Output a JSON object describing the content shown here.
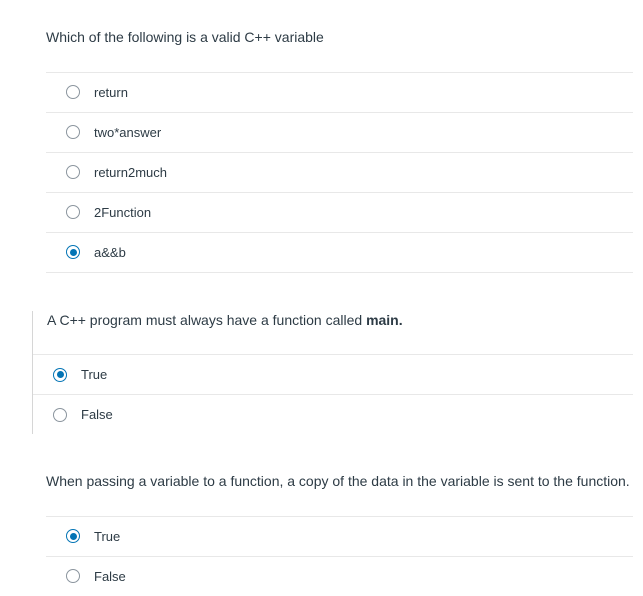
{
  "questions": [
    {
      "prompt_html": "Which of the following is a valid C++ variable",
      "options": [
        {
          "label": "return",
          "selected": false
        },
        {
          "label": "two*answer",
          "selected": false
        },
        {
          "label": "return2much",
          "selected": false
        },
        {
          "label": "2Function",
          "selected": false
        },
        {
          "label": "a&&b",
          "selected": true
        }
      ]
    },
    {
      "prompt_html": "A C++ program must always have a function called <strong>main.</strong>",
      "options": [
        {
          "label": "True",
          "selected": true
        },
        {
          "label": "False",
          "selected": false
        }
      ]
    },
    {
      "prompt_html": "When passing a variable to a function, a copy of the data in the variable is sent to the function.",
      "options": [
        {
          "label": "True",
          "selected": true
        },
        {
          "label": "False",
          "selected": false
        }
      ]
    }
  ]
}
